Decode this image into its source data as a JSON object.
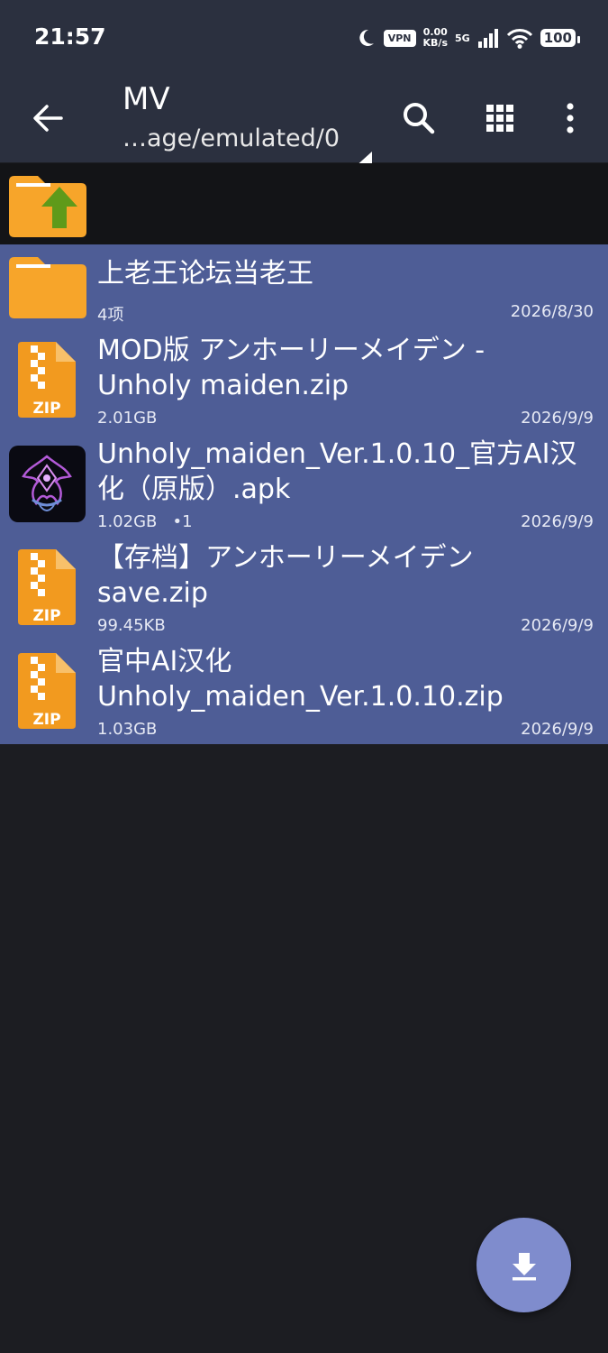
{
  "status_bar": {
    "time": "21:57",
    "vpn": "VPN",
    "speed_value": "0.00",
    "speed_unit": "KB/s",
    "network": "5G",
    "battery": "100"
  },
  "toolbar": {
    "title": "MV",
    "path": "…age/emulated/0"
  },
  "parent_entry": {
    "label": ".."
  },
  "items": [
    {
      "name_line1": "上老王论坛当老王",
      "name_line2": "",
      "meta": "4项",
      "date": "2026/8/30",
      "icon": "folder-icon"
    },
    {
      "name_line1": "MOD版 アンホーリーメイデン -",
      "name_line2": "Unholy maiden.zip",
      "meta": "2.01GB",
      "date": "2026/9/9",
      "icon": "zip-file-icon"
    },
    {
      "name_line1": "Unholy_maiden_Ver.1.0.10_官方AI汉",
      "name_line2": "化（原版）.apk",
      "meta": "1.02GB   •1",
      "date": "2026/9/9",
      "icon": "apk-app-icon"
    },
    {
      "name_line1": "【存档】アンホーリーメイデン",
      "name_line2": "save.zip",
      "meta": "99.45KB",
      "date": "2026/9/9",
      "icon": "zip-file-icon"
    },
    {
      "name_line1": "官中AI汉化",
      "name_line2": "Unholy_maiden_Ver.1.0.10.zip",
      "meta": "1.03GB",
      "date": "2026/9/9",
      "icon": "zip-file-icon"
    }
  ],
  "zip_label": "ZIP",
  "colors": {
    "toolbar_bg": "#2b303f",
    "selection_bg": "#4e5d96",
    "folder": "#f7a52a",
    "zip": "#f29a1f",
    "up_arrow": "#5f9a1a",
    "fab": "#7f8ccd"
  }
}
